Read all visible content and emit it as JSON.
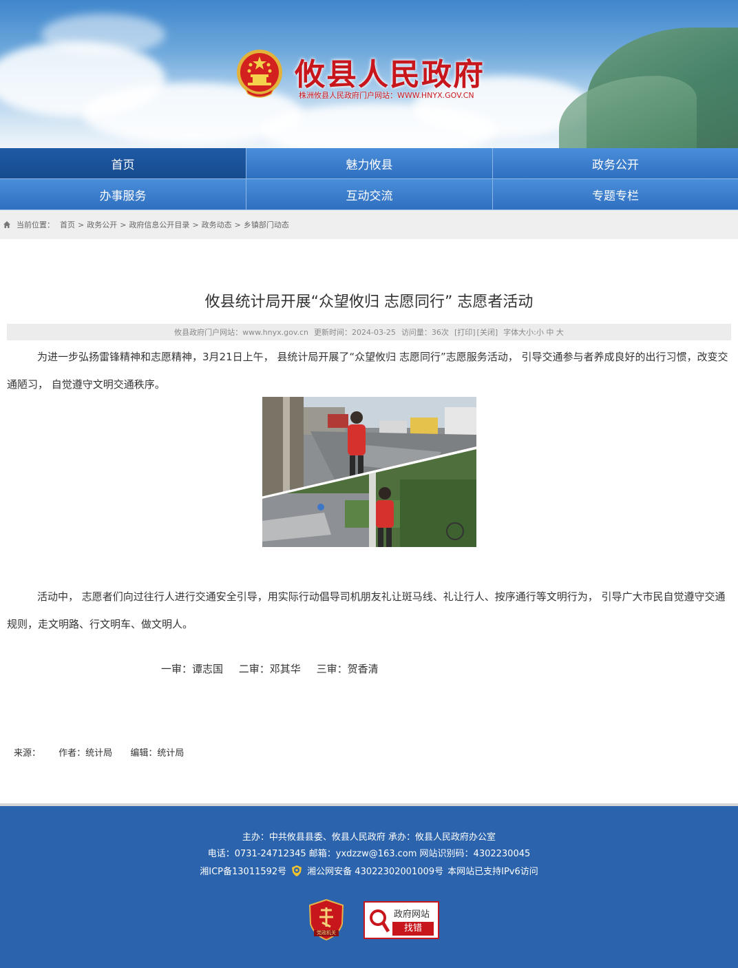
{
  "header": {
    "site_title": "攸县人民政府",
    "site_subtitle": "株洲攸县人民政府门户网站：WWW.HNYX.GOV.CN"
  },
  "nav": {
    "items": [
      {
        "label": "首页"
      },
      {
        "label": "魅力攸县"
      },
      {
        "label": "政务公开"
      },
      {
        "label": "办事服务"
      },
      {
        "label": "互动交流"
      },
      {
        "label": "专题专栏"
      }
    ],
    "active_index": 0
  },
  "breadcrumb": {
    "prefix": "当前位置：",
    "items": [
      "首页",
      "政务公开",
      "政府信息公开目录",
      "政务动态",
      "乡镇部门动态"
    ],
    "separator": ">"
  },
  "article": {
    "title": "攸县统计局开展“众望攸归 志愿同行” 志愿者活动",
    "meta": {
      "site": "攸县政府门户网站：www.hnyx.gov.cn",
      "updated": "更新时间：2024-03-25",
      "views": "访问量：36次",
      "print": "[打印]",
      "close": "[关闭]",
      "font_size": "字体大小:小 中 大"
    },
    "paragraph1": "为进一步弘扬雷锋精神和志愿精神，3月21日上午， 县统计局开展了“众望攸归  志愿同行”志愿服务活动， 引导交通参与者养成良好的出行习惯，改变交通陋习， 自觉遵守文明交通秩序。",
    "paragraph2": "活动中， 志愿者们向过往行人进行交通安全引导，用实际行动倡导司机朋友礼让斑马线、礼让行人、按序通行等文明行为， 引导广大市民自觉遵守交通规则，走文明路、行文明车、做文明人。",
    "review": {
      "first": "一审：谭志国",
      "second": "二审：邓其华",
      "third": "三审：贺香清"
    },
    "source": {
      "source": "来源：",
      "author": "作者：统计局",
      "editor": "编辑：统计局"
    }
  },
  "footer": {
    "line1": "主办：中共攸县县委、攸县人民政府 承办：攸县人民政府办公室",
    "line2": "电话：0731-24712345   邮箱：yxdzzw@163.com   网站识别码：4302230045",
    "icp": "湘ICP备13011592号",
    "police": "湘公网安备 43022302001009号",
    "ipv6": "本网站已支持IPv6访问",
    "party_badge": "党政机关",
    "error_title": "政府网站",
    "error_action": "找错"
  },
  "colors": {
    "brand_red": "#c8161d",
    "nav_blue": "#2f6fc0",
    "nav_active": "#174b8e",
    "footer_blue": "#2b63ac"
  }
}
